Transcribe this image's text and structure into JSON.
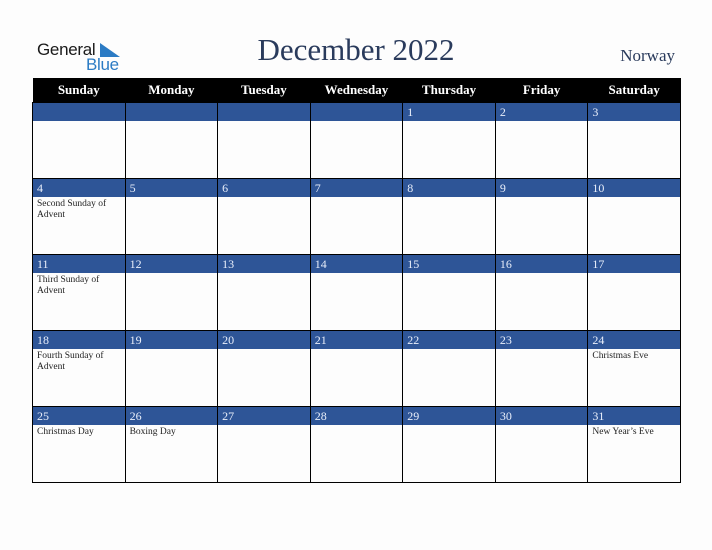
{
  "logo": {
    "word1": "General",
    "word2": "Blue"
  },
  "title": "December 2022",
  "country": "Norway",
  "colors": {
    "header_bg": "#000000",
    "daynum_bg": "#2e5597",
    "title": "#2a3b5c",
    "logo_blue": "#2b7bc4"
  },
  "weekdays": [
    "Sunday",
    "Monday",
    "Tuesday",
    "Wednesday",
    "Thursday",
    "Friday",
    "Saturday"
  ],
  "weeks": [
    [
      {
        "day": "",
        "event": ""
      },
      {
        "day": "",
        "event": ""
      },
      {
        "day": "",
        "event": ""
      },
      {
        "day": "",
        "event": ""
      },
      {
        "day": "1",
        "event": ""
      },
      {
        "day": "2",
        "event": ""
      },
      {
        "day": "3",
        "event": ""
      }
    ],
    [
      {
        "day": "4",
        "event": "Second Sunday of Advent"
      },
      {
        "day": "5",
        "event": ""
      },
      {
        "day": "6",
        "event": ""
      },
      {
        "day": "7",
        "event": ""
      },
      {
        "day": "8",
        "event": ""
      },
      {
        "day": "9",
        "event": ""
      },
      {
        "day": "10",
        "event": ""
      }
    ],
    [
      {
        "day": "11",
        "event": "Third Sunday of Advent"
      },
      {
        "day": "12",
        "event": ""
      },
      {
        "day": "13",
        "event": ""
      },
      {
        "day": "14",
        "event": ""
      },
      {
        "day": "15",
        "event": ""
      },
      {
        "day": "16",
        "event": ""
      },
      {
        "day": "17",
        "event": ""
      }
    ],
    [
      {
        "day": "18",
        "event": "Fourth Sunday of Advent"
      },
      {
        "day": "19",
        "event": ""
      },
      {
        "day": "20",
        "event": ""
      },
      {
        "day": "21",
        "event": ""
      },
      {
        "day": "22",
        "event": ""
      },
      {
        "day": "23",
        "event": ""
      },
      {
        "day": "24",
        "event": "Christmas Eve"
      }
    ],
    [
      {
        "day": "25",
        "event": "Christmas Day"
      },
      {
        "day": "26",
        "event": "Boxing Day"
      },
      {
        "day": "27",
        "event": ""
      },
      {
        "day": "28",
        "event": ""
      },
      {
        "day": "29",
        "event": ""
      },
      {
        "day": "30",
        "event": ""
      },
      {
        "day": "31",
        "event": "New Year’s Eve"
      }
    ]
  ]
}
